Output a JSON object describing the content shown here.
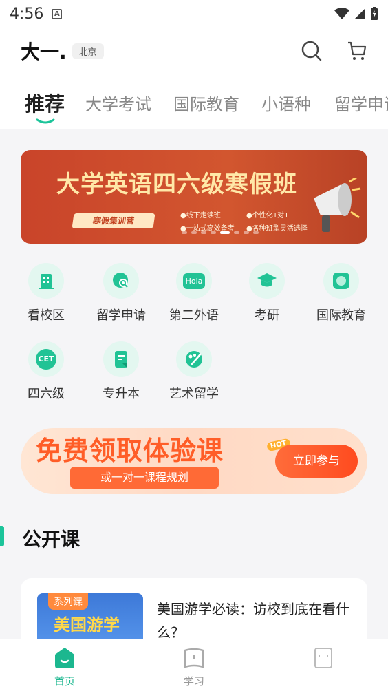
{
  "status": {
    "time": "4:56",
    "a_icon": "A"
  },
  "header": {
    "logo_text": "大一.",
    "city": "北京"
  },
  "tabs": [
    {
      "label": "推荐",
      "active": true
    },
    {
      "label": "大学考试"
    },
    {
      "label": "国际教育"
    },
    {
      "label": "小语种"
    },
    {
      "label": "留学申请"
    }
  ],
  "banner": {
    "title": "大学英语四六级寒假班",
    "subtitle": "寒假集训营",
    "bullets": [
      "●线下走读班",
      "●个性化1对1",
      "●一站式高效备考",
      "●各种班型灵活选择"
    ]
  },
  "categories": [
    {
      "label": "看校区",
      "icon": "building-icon"
    },
    {
      "label": "留学申请",
      "icon": "globe-search-icon"
    },
    {
      "label": "第二外语",
      "icon": "hola-icon",
      "icon_text": "Hola"
    },
    {
      "label": "考研",
      "icon": "graduation-cap-icon"
    },
    {
      "label": "国际教育",
      "icon": "globe-icon"
    },
    {
      "label": "四六级",
      "icon": "cet-icon",
      "icon_text": "CET"
    },
    {
      "label": "专升本",
      "icon": "scroll-icon"
    },
    {
      "label": "艺术留学",
      "icon": "palette-icon"
    }
  ],
  "promo": {
    "title": "免费领取体验课",
    "subtitle": "或一对一课程规划",
    "button": "立即参与",
    "hot": "HOT"
  },
  "section": {
    "title": "公开课"
  },
  "course": {
    "tag": "系列课",
    "thumb_title": "美国游学",
    "title": "美国游学必读：访校到底在看什么？"
  },
  "bottom_nav": [
    {
      "label": "首页",
      "active": true
    },
    {
      "label": "学习"
    },
    {
      "label": ""
    }
  ],
  "colors": {
    "accent": "#1cc49a",
    "promo": "#ff5d27",
    "banner": "#c9442a"
  }
}
